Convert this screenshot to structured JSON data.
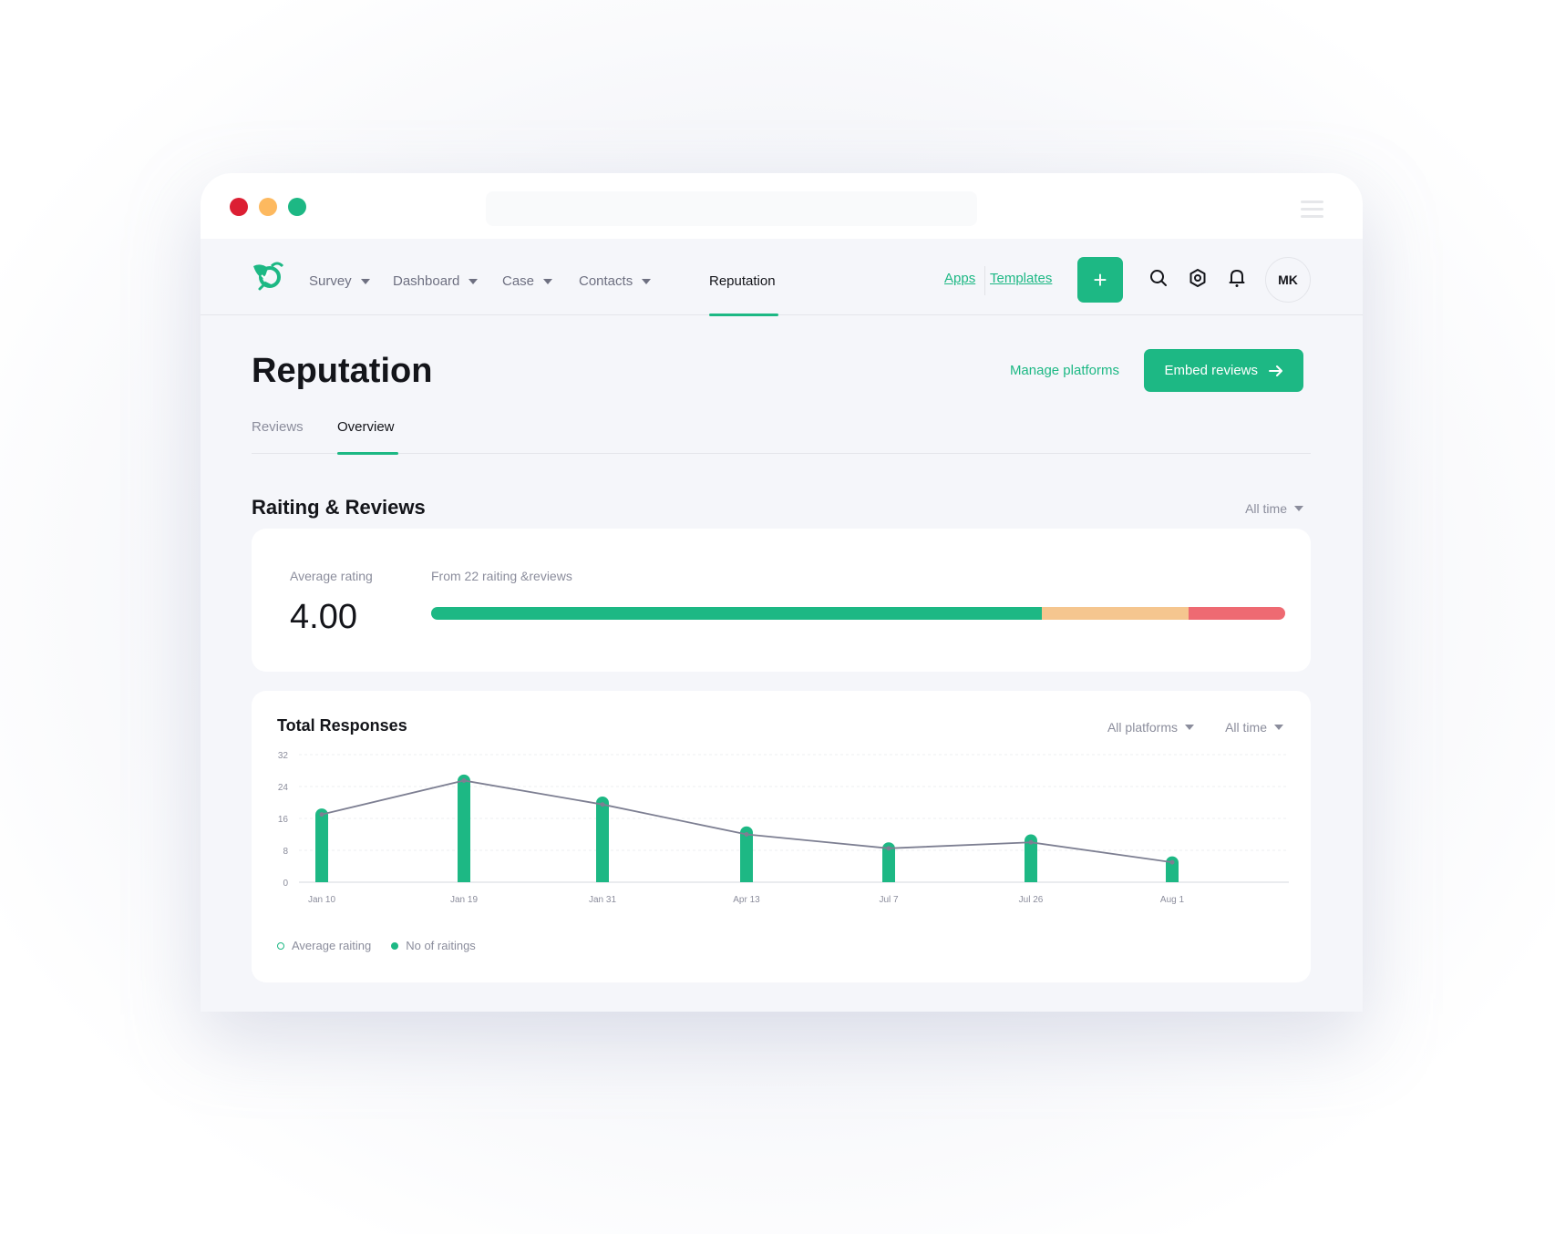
{
  "window": {
    "controls": [
      "close",
      "minimize",
      "maximize"
    ],
    "menu_icon": "hamburger-icon"
  },
  "nav": {
    "items": [
      {
        "label": "Survey",
        "has_dropdown": true
      },
      {
        "label": "Dashboard",
        "has_dropdown": true
      },
      {
        "label": "Case",
        "has_dropdown": true
      },
      {
        "label": "Contacts",
        "has_dropdown": true
      },
      {
        "label": "Reputation",
        "has_dropdown": false,
        "active": true
      }
    ],
    "apps_label": "Apps",
    "templates_label": "Templates",
    "add_label": "+",
    "avatar_initials": "MK"
  },
  "page": {
    "title": "Reputation",
    "manage_label": "Manage platforms",
    "embed_label": "Embed reviews",
    "tabs": [
      {
        "label": "Reviews",
        "active": false
      },
      {
        "label": "Overview",
        "active": true
      }
    ]
  },
  "ratings": {
    "section_title": "Raiting & Reviews",
    "period": "All time",
    "avg_label": "Average rating",
    "avg_value": "4.00",
    "from_label": "From 22 raiting &reviews",
    "distribution": [
      {
        "name": "positive",
        "fraction": 0.715,
        "color": "#1db884"
      },
      {
        "name": "neutral",
        "fraction": 0.172,
        "color": "#f5c68f"
      },
      {
        "name": "negative",
        "fraction": 0.113,
        "color": "#ee6a72"
      }
    ]
  },
  "responses": {
    "title": "Total Responses",
    "platform_filter": "All platforms",
    "period_filter": "All time"
  },
  "colors": {
    "accent": "#1db884",
    "line": "#7d7f92",
    "text_muted": "#8b8d9c"
  },
  "chart_data": {
    "type": "bar",
    "title": "Total Responses",
    "categories": [
      "Jan 10",
      "Jan 19",
      "Jan 31",
      "Apr 13",
      "Jul 7",
      "Jul 26",
      "Aug 1"
    ],
    "series": [
      {
        "name": "No of raitings",
        "type": "bar",
        "values": [
          18.5,
          27,
          21.5,
          14,
          10,
          12,
          6.5
        ]
      },
      {
        "name": "Average raiting",
        "type": "line",
        "values": [
          17,
          25.5,
          19.5,
          12,
          8.5,
          10,
          5
        ]
      }
    ],
    "yticks": [
      0,
      8,
      16,
      24,
      32
    ],
    "ylim": [
      0,
      32
    ],
    "xlabel": "",
    "ylabel": "",
    "grid": true,
    "legend": [
      {
        "label": "Average raiting",
        "style": "hollow"
      },
      {
        "label": "No of raitings",
        "style": "filled"
      }
    ],
    "legend_position": "bottom-left"
  }
}
